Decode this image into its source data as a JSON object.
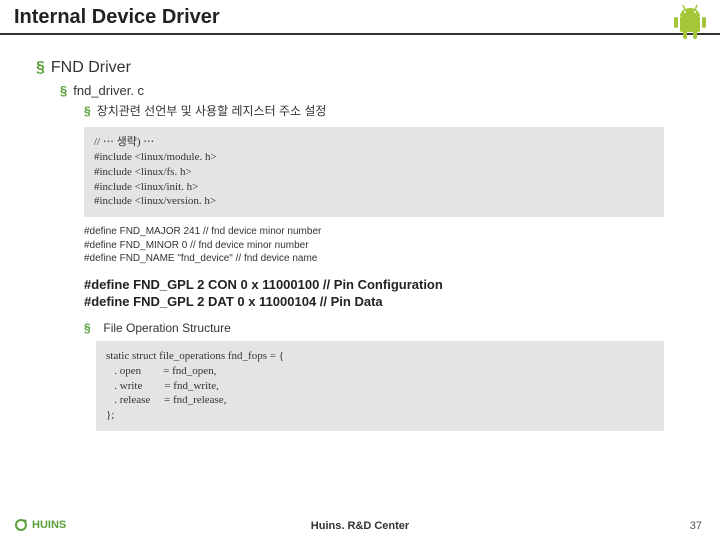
{
  "title": "Internal Device Driver",
  "lvl1": "FND Driver",
  "lvl2": "fnd_driver. c",
  "lvl3a": "장치관련 선언부 및 사용할 레지스터 주소 설정",
  "code1": "// ⋯ 생략) ⋯\n#include <linux/module. h>\n#include <linux/fs. h>\n#include <linux/init. h>\n#include <linux/version. h>",
  "defs": "#define FND_MAJOR 241 // fnd device minor number\n#define FND_MINOR 0 // fnd device minor number\n#define FND_NAME \"fnd_device\" // fnd device name",
  "bigdef": "#define FND_GPL 2 CON 0 x 11000100 // Pin Configuration\n#define FND_GPL 2 DAT 0 x 11000104 // Pin Data",
  "lvl3b": "File Operation Structure",
  "code2": "static struct file_operations fnd_fops = {\n   . open        = fnd_open,\n   . write        = fnd_write,\n   . release     = fnd_release,\n};",
  "footer": "Huins. R&D Center",
  "page": "37",
  "logo": "HUINS"
}
